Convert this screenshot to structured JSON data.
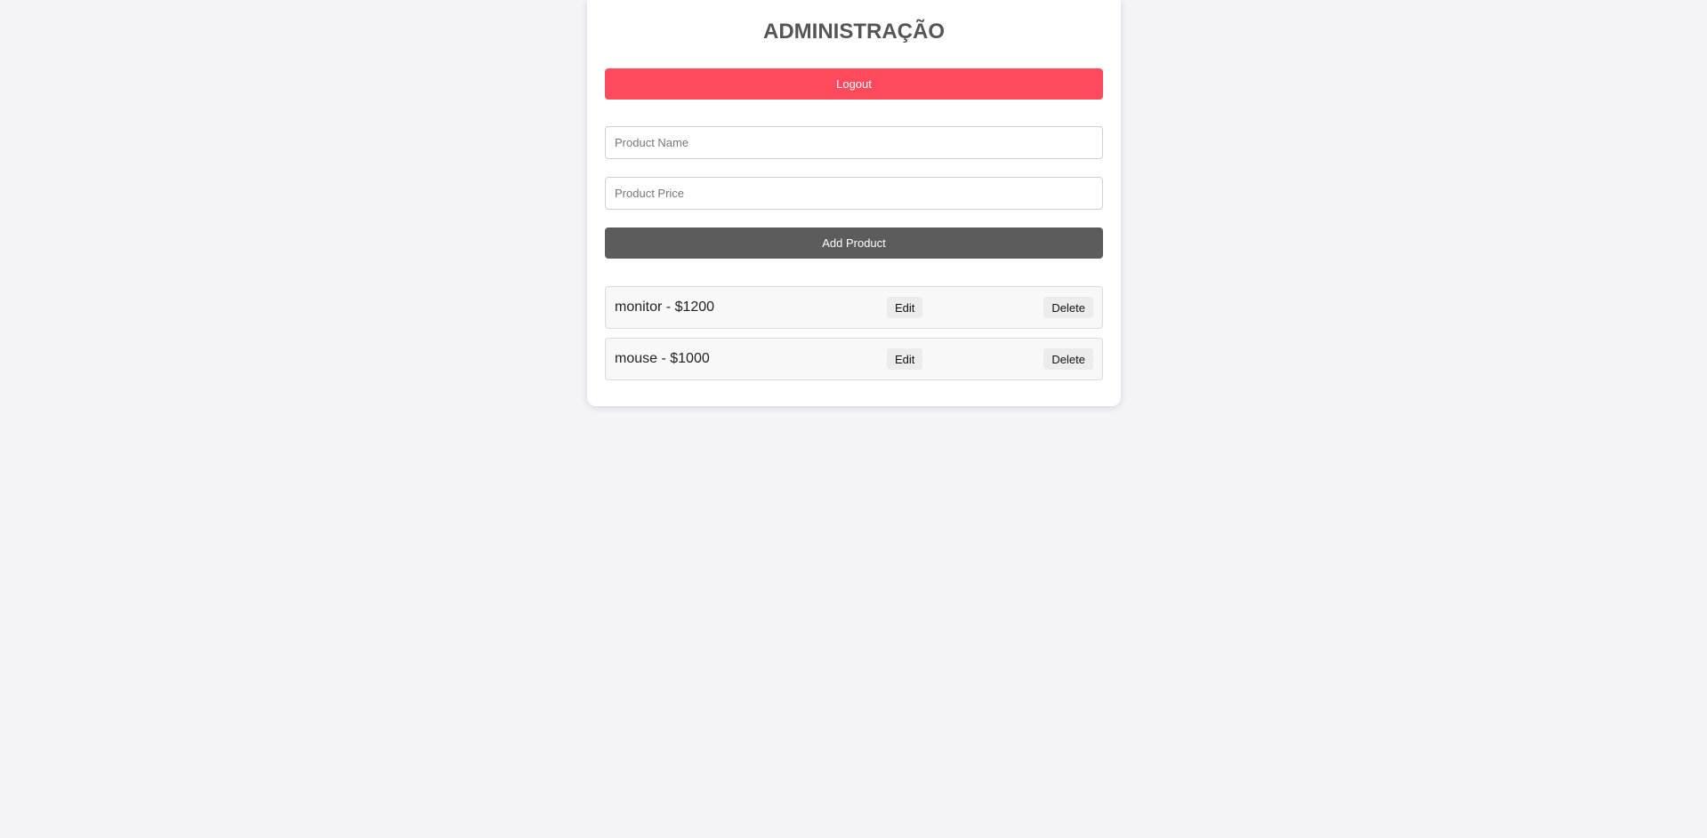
{
  "header": {
    "title": "ADMINISTRAÇÃO"
  },
  "actions": {
    "logout_label": "Logout",
    "add_label": "Add Product"
  },
  "form": {
    "name_placeholder": "Product Name",
    "name_value": "",
    "price_placeholder": "Product Price",
    "price_value": ""
  },
  "products": [
    {
      "text": "monitor - $1200",
      "edit_label": "Edit",
      "delete_label": "Delete"
    },
    {
      "text": "mouse - $1000",
      "edit_label": "Edit",
      "delete_label": "Delete"
    }
  ],
  "colors": {
    "background": "#f3f3f8",
    "logout": "#ff4a5e",
    "add": "#5c5c5c",
    "title": "#555555"
  }
}
